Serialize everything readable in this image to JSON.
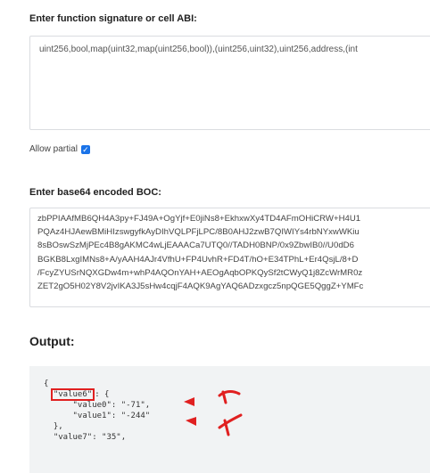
{
  "signature": {
    "label": "Enter function signature or cell ABI:",
    "value": "uint256,bool,map(uint32,map(uint256,bool)),(uint256,uint32),uint256,address,(int"
  },
  "allow_partial": {
    "label": "Allow partial",
    "checked": true
  },
  "boc": {
    "label": "Enter base64 encoded BOC:",
    "lines": [
      "zbPPIAAfMB6QH4A3py+FJ49A+OgYjf+E0jiNs8+EkhxwXy4TD4AFmOHiCRW+H4U1",
      "PQAz4HJAewBMiHIzswgyfkAyDIhVQLPFjLPC/8B0AHJ2zwB7QIWIYs4rbNYxwWKiu",
      "8sBOswSzMjPEc4B8gAKMC4wLjEAAACa7UTQ0//TADH0BNP/0x9ZbwIB0//U0dD6",
      "BGKB8LxgIMNs8+A/yAAH4AJr4VfhU+FP4UvhR+FD4T/hO+E34TPhL+Er4QsjL/8+D",
      "/FcyZYUSrNQXGDw4m+whP4AQOnYAH+AEOgAqbOPKQySf2tCWyQ1j8ZcWrMR0z",
      "ZET2gO5H02Y8V2jvIKA3J5sHw4cqjF4AQK9AgYAQ6ADzxgcz5npQGE5QggZ+YMFc"
    ]
  },
  "output": {
    "title": "Output:",
    "lines": {
      "l0": "{",
      "l1_key": "\"value6\"",
      "l1_rest": ": {",
      "l2": "    \"value0\": \"-71\",",
      "l3": "    \"value1\": \"-244\"",
      "l4": "},",
      "l5": "\"value7\": \"35\","
    }
  },
  "colors": {
    "accent": "#1a73e8",
    "annotation": "#e02020",
    "output_bg": "#f1f3f4"
  }
}
